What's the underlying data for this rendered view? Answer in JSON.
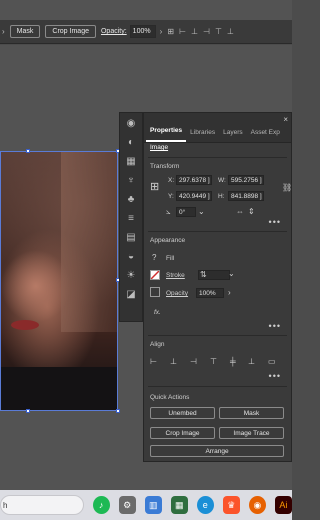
{
  "controlbar": {
    "mask_label": "Mask",
    "crop_label": "Crop Image",
    "opacity_label": "Opacity:",
    "opacity_value": "100%"
  },
  "panel": {
    "tabs": [
      "Properties",
      "Libraries",
      "Layers",
      "Asset Exp"
    ],
    "object_type": "Image",
    "transform": {
      "title": "Transform",
      "x_label": "X:",
      "x_value": "297.6378 ]",
      "y_label": "Y:",
      "y_value": "420.9449 ]",
      "w_label": "W:",
      "w_value": "595.2756 ]",
      "h_label": "H:",
      "h_value": "841.8898 ]",
      "rotate_value": "0°"
    },
    "appearance": {
      "title": "Appearance",
      "fill_label": "Fill",
      "stroke_label": "Stroke",
      "opacity_label": "Opacity",
      "opacity_value": "100%",
      "fx_label": "fx."
    },
    "align": {
      "title": "Align"
    },
    "quick_actions": {
      "title": "Quick Actions",
      "unembed": "Unembed",
      "mask": "Mask",
      "crop_image": "Crop Image",
      "image_trace": "Image Trace",
      "arrange": "Arrange"
    }
  },
  "taskbar": {
    "search_text": "h"
  },
  "colors": {
    "panel_bg": "#3a3a3a",
    "canvas_bg": "#535353",
    "selection": "#3a5fc9",
    "stroke_swatch": "#d03030"
  }
}
